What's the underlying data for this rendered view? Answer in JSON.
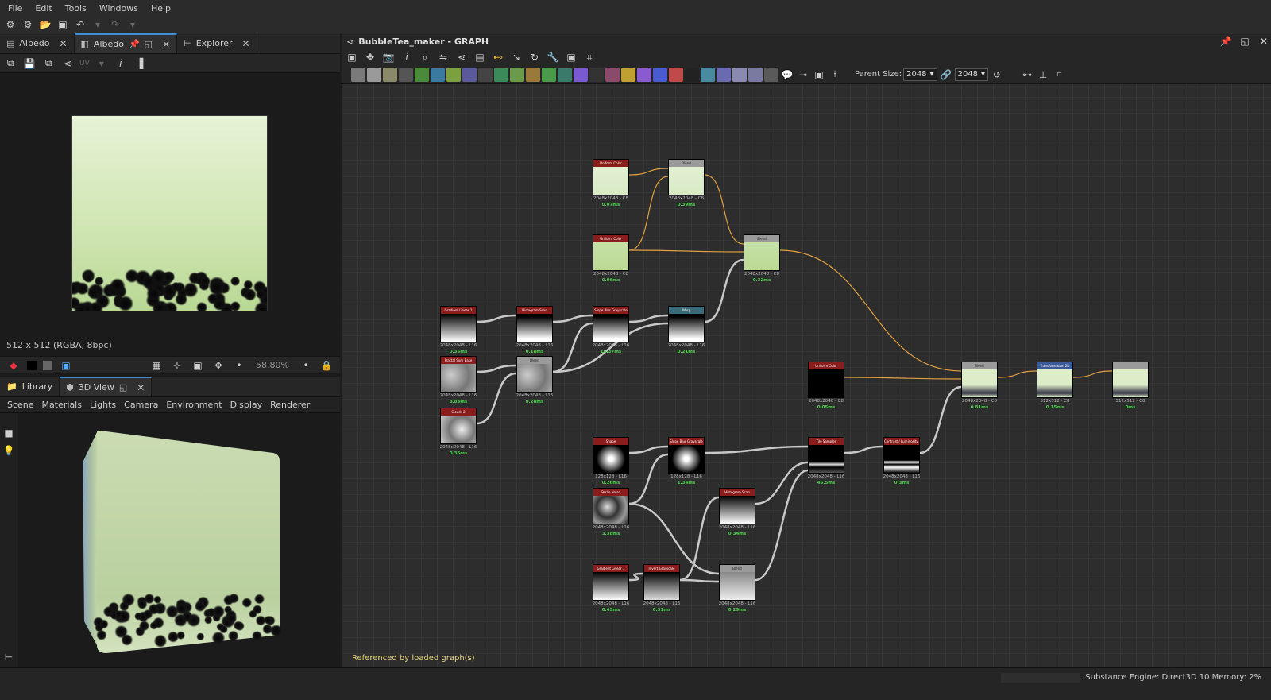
{
  "menubar": {
    "items": [
      "File",
      "Edit",
      "Tools",
      "Windows",
      "Help"
    ]
  },
  "view2d": {
    "tabs": [
      {
        "label": "Albedo"
      },
      {
        "label": "Albedo"
      },
      {
        "label": "Explorer"
      }
    ],
    "uv_label": "UV",
    "resolution": "512 x 512 (RGBA, 8bpc)",
    "zoom": "58.80%"
  },
  "view3d": {
    "tabs": [
      {
        "label": "Library"
      },
      {
        "label": "3D View"
      }
    ],
    "menu": [
      "Scene",
      "Materials",
      "Lights",
      "Camera",
      "Environment",
      "Display",
      "Renderer"
    ]
  },
  "graph": {
    "title": "BubbleTea_maker - GRAPH",
    "parent_size_label": "Parent Size:",
    "width_value": "2048",
    "height_value": "2048",
    "referenced_label": "Referenced by loaded graph(s)",
    "nodes": [
      {
        "title": "Uniform Color",
        "res": "2048x2048 - C8",
        "time": "0.07ms"
      },
      {
        "title": "Blend",
        "res": "2048x2048 - C8",
        "time": "0.39ms"
      },
      {
        "title": "Uniform Color",
        "res": "2048x2048 - C8",
        "time": "0.06ms"
      },
      {
        "title": "Blend",
        "res": "2048x2048 - C8",
        "time": "0.32ms"
      },
      {
        "title": "Gradient Linear 1",
        "res": "2048x2048 - L16",
        "time": "0.35ms"
      },
      {
        "title": "Histogram Scan",
        "res": "2048x2048 - L16",
        "time": "0.18ms"
      },
      {
        "title": "Slope Blur Grayscale",
        "res": "2048x2048 - L16",
        "time": "16.37ms"
      },
      {
        "title": "Warp",
        "res": "2048x2048 - L16",
        "time": "0.21ms"
      },
      {
        "title": "Fractal Sum Base",
        "res": "2048x2048 - L16",
        "time": "8.83ms"
      },
      {
        "title": "Blend",
        "res": "2048x2048 - L16",
        "time": "0.28ms"
      },
      {
        "title": "Clouds 2",
        "res": "2048x2048 - L16",
        "time": "0.36ms"
      },
      {
        "title": "Uniform Color",
        "res": "2048x2048 - C8",
        "time": "0.05ms"
      },
      {
        "title": "Blend",
        "res": "2048x2048 - C8",
        "time": "0.81ms"
      },
      {
        "title": "Transformation 2D",
        "res": "512x512 - C8",
        "time": "0.15ms"
      },
      {
        "title": "",
        "res": "512x512 - C8",
        "time": "0ms"
      },
      {
        "title": "Shape",
        "res": "128x128 - L16",
        "time": "0.26ms"
      },
      {
        "title": "Slope Blur Grayscale",
        "res": "128x128 - L16",
        "time": "1.34ms"
      },
      {
        "title": "Tile Sampler",
        "res": "2048x2048 - L16",
        "time": "45.5ms"
      },
      {
        "title": "Contrast / Luminosity G...",
        "res": "2048x2048 - L16",
        "time": "0.3ms"
      },
      {
        "title": "Perlin Noise",
        "res": "2048x2048 - L16",
        "time": "3.38ms"
      },
      {
        "title": "Histogram Scan",
        "res": "2048x2048 - L16",
        "time": "0.34ms"
      },
      {
        "title": "Gradient Linear 1",
        "res": "2048x2048 - L16",
        "time": "0.45ms"
      },
      {
        "title": "Invert Grayscale",
        "res": "2048x2048 - L16",
        "time": "0.31ms"
      },
      {
        "title": "Blend",
        "res": "2048x2048 - L16",
        "time": "0.29ms"
      }
    ]
  },
  "status": {
    "text": "Substance Engine: Direct3D 10  Memory: 2%"
  },
  "colors": {
    "accent": "#3d8fd6",
    "node_header": "#8a1c1c",
    "link_color": "#e0a040",
    "time_green": "#4cd34c"
  }
}
